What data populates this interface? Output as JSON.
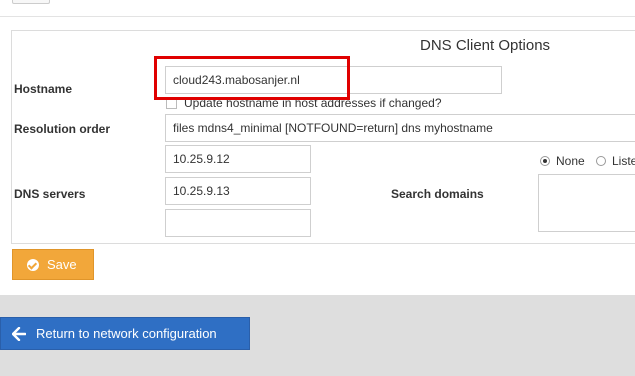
{
  "panel": {
    "title": "DNS Client Options"
  },
  "hostname": {
    "label": "Hostname",
    "value": "cloud243.mabosanjer.nl",
    "update_checkbox_label": "Update hostname in host addresses if changed?"
  },
  "resolution_order": {
    "label": "Resolution order",
    "value": "files mdns4_minimal [NOTFOUND=return] dns myhostname"
  },
  "dns_servers": {
    "label": "DNS servers",
    "values": [
      "10.25.9.12",
      "10.25.9.13",
      ""
    ]
  },
  "search_domains": {
    "label": "Search domains",
    "options": [
      "None",
      "Liste"
    ],
    "selected": "None"
  },
  "actions": {
    "save_label": "Save",
    "return_label": "Return to network configuration"
  },
  "colors": {
    "save": "#f2a73a",
    "return": "#2f6fc4",
    "highlight": "#e00000"
  }
}
